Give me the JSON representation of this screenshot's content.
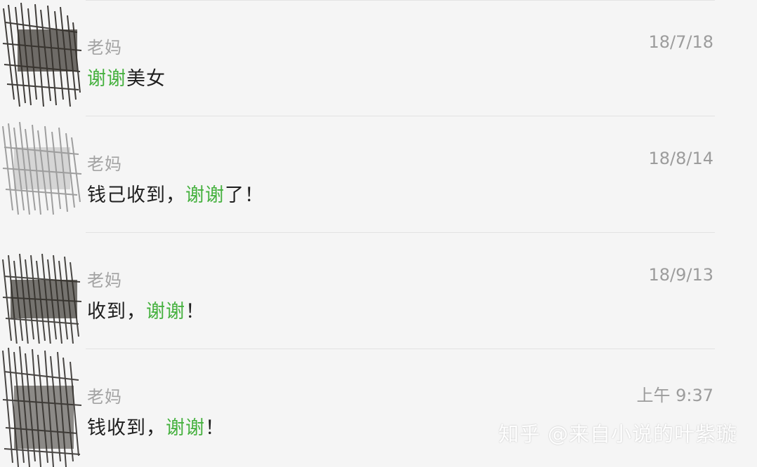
{
  "conversations": [
    {
      "sender": "老妈",
      "time": "18/7/18",
      "message": [
        {
          "text": "谢谢",
          "highlight": true
        },
        {
          "text": "美女",
          "highlight": false
        }
      ]
    },
    {
      "sender": "老妈",
      "time": "18/8/14",
      "message": [
        {
          "text": "钱己收到，",
          "highlight": false
        },
        {
          "text": "谢谢",
          "highlight": true
        },
        {
          "text": "了！",
          "highlight": false
        }
      ]
    },
    {
      "sender": "老妈",
      "time": "18/9/13",
      "message": [
        {
          "text": "收到，",
          "highlight": false
        },
        {
          "text": "谢谢",
          "highlight": true
        },
        {
          "text": "！",
          "highlight": false
        }
      ]
    },
    {
      "sender": "老妈",
      "time": "上午 9:37",
      "message": [
        {
          "text": "钱收到，",
          "highlight": false
        },
        {
          "text": "谢谢",
          "highlight": true
        },
        {
          "text": "！",
          "highlight": false
        }
      ]
    }
  ],
  "watermark": "知乎 @来自小说的叶紫璇",
  "colors": {
    "background": "#f5f5f5",
    "keyword_highlight": "#46b13f",
    "sender_text": "#a3a3a3",
    "time_text": "#9c9c9c",
    "message_text": "#1e1e1e"
  }
}
